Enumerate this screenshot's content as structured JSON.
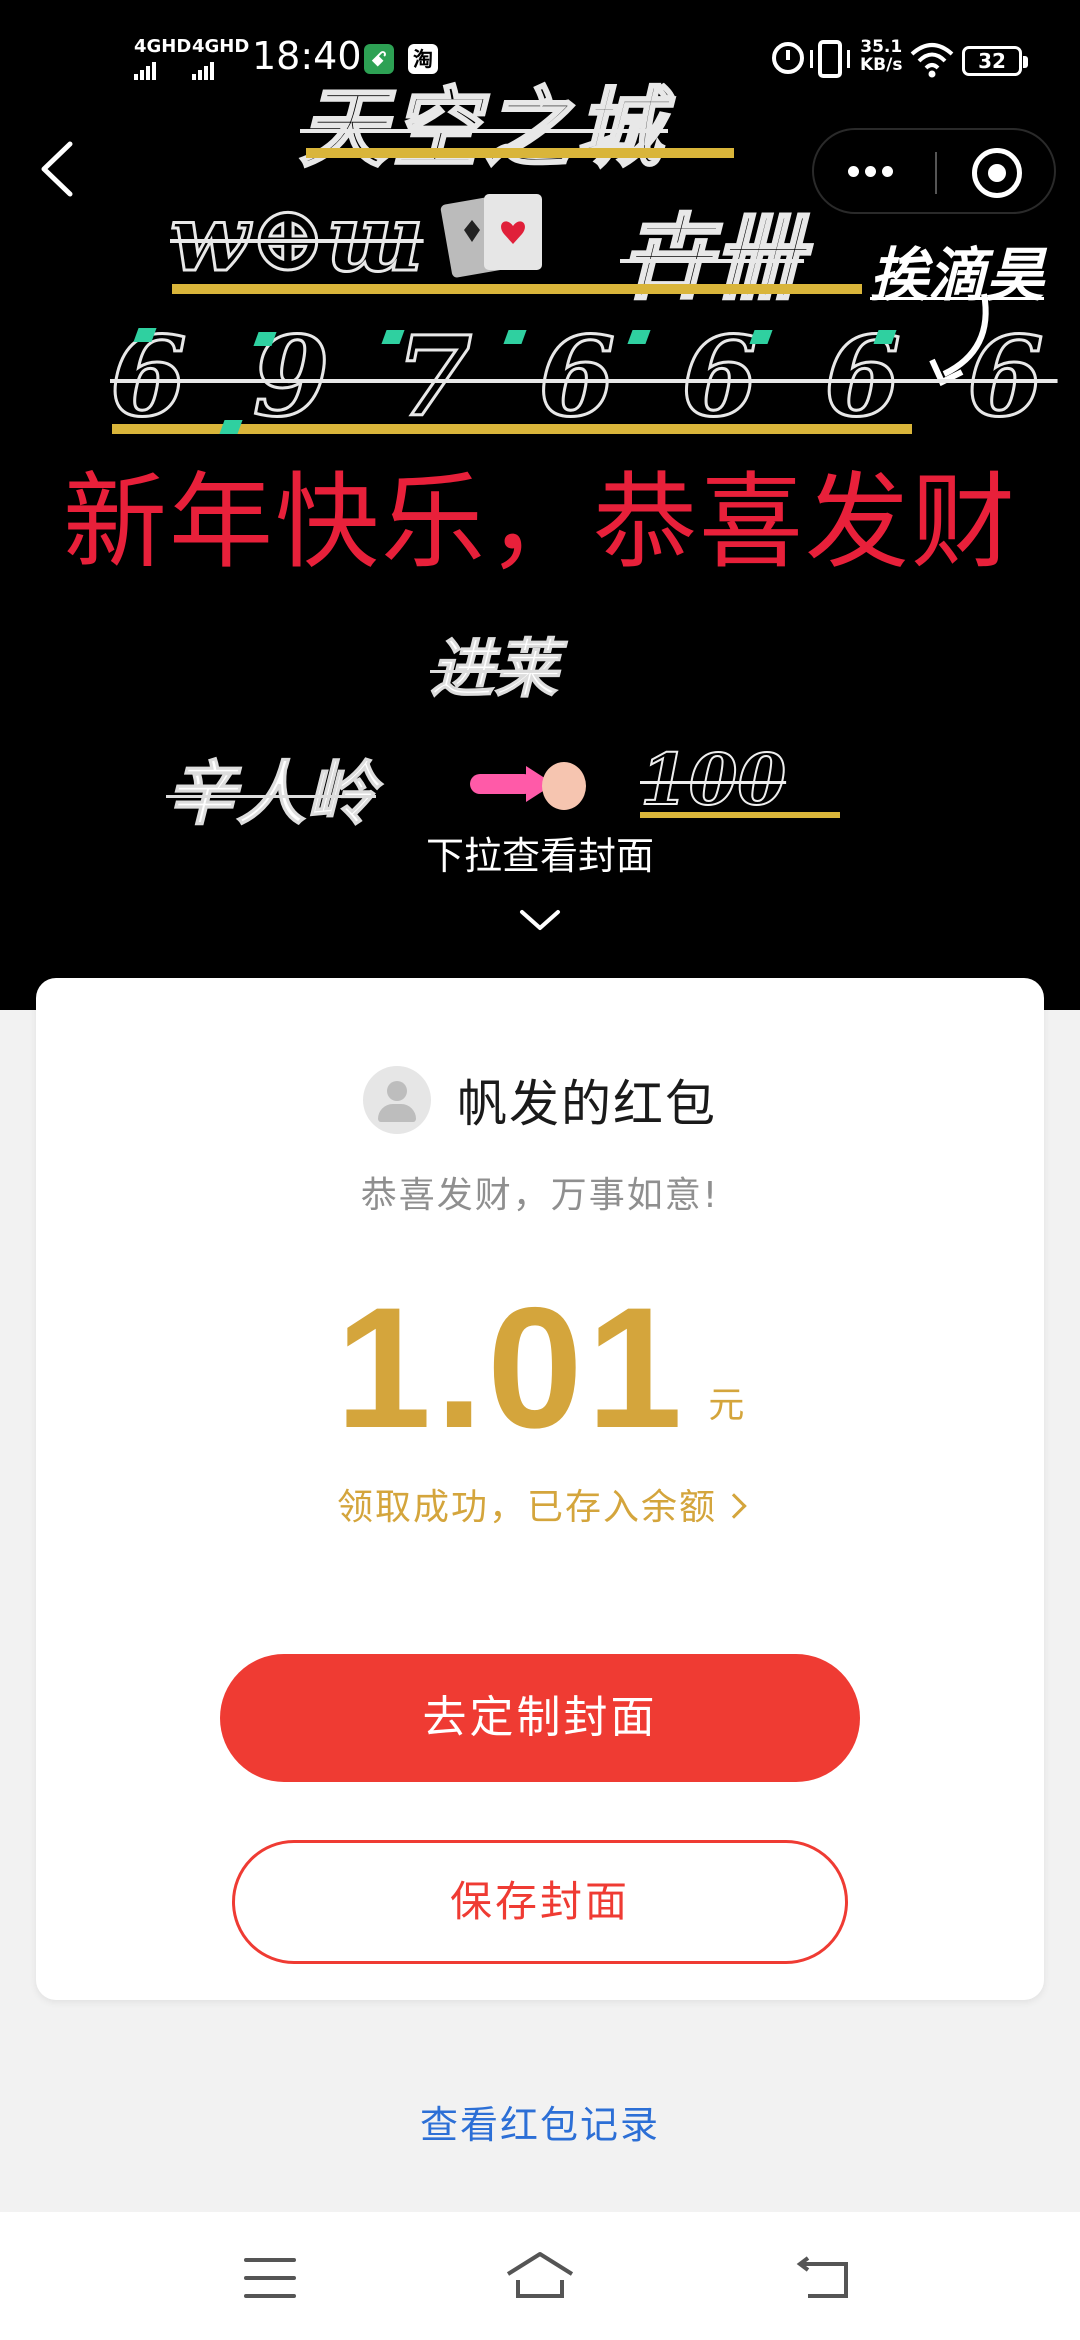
{
  "status_bar": {
    "network_1": "4GHD",
    "network_2": "4GHD",
    "time": "18:40",
    "app_icon_2": "淘",
    "net_speed_value": "35.1",
    "net_speed_unit": "KB/s",
    "battery": "32"
  },
  "cover": {
    "art_title": "天空之城",
    "art_row2": "w⊕ɯ",
    "art_row2_right": "卋卌",
    "art_author": "挨滴昊",
    "art_digits": "6 9 7 6 6 6 6",
    "greeting": "新年快乐，恭喜发财",
    "art_word_1": "进莱",
    "art_word_2": "辛人岭",
    "art_word_3": "100",
    "pull_hint": "下拉查看封面"
  },
  "packet": {
    "sender": "帆发的红包",
    "blessing": "恭喜发财，万事如意!",
    "amount": "1.01",
    "unit": "元",
    "status": "领取成功，已存入余额",
    "customize_button": "去定制封面",
    "save_button": "保存封面"
  },
  "records_link": "查看红包记录",
  "colors": {
    "accent_red": "#ef3b33",
    "amount_gold": "#d4a53c",
    "link_blue": "#2c6fd6",
    "greeting_red": "#e8203a"
  }
}
